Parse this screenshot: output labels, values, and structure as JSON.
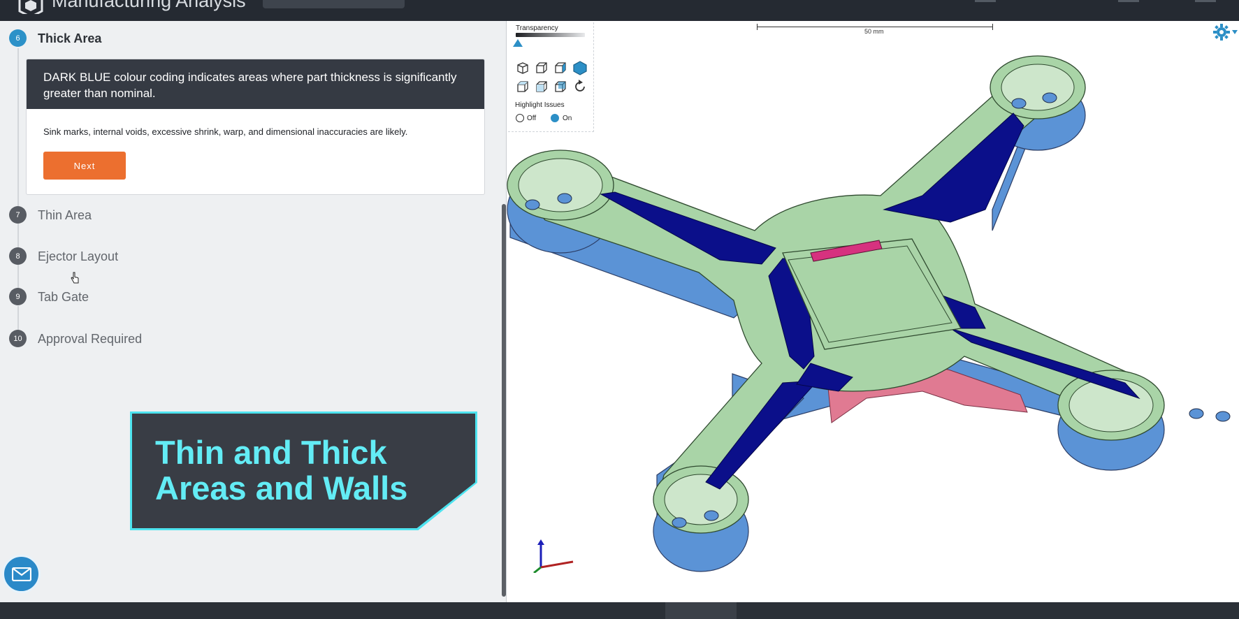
{
  "app": {
    "title": "Manufacturing Analysis",
    "logo_icon": "cube-logo-icon"
  },
  "steps": [
    {
      "number": "6",
      "label": "Thick Area",
      "active": true
    },
    {
      "number": "7",
      "label": "Thin Area",
      "active": false
    },
    {
      "number": "8",
      "label": "Ejector Layout",
      "active": false
    },
    {
      "number": "9",
      "label": "Tab Gate",
      "active": false
    },
    {
      "number": "10",
      "label": "Approval Required",
      "active": false
    }
  ],
  "card": {
    "heading": "DARK BLUE colour coding indicates areas where part thickness is significantly greater than nominal.",
    "body": "Sink marks, internal voids, excessive shrink, warp, and dimensional inaccuracies are likely.",
    "next_label": "Next"
  },
  "overlay": {
    "title": "Thin and Thick Areas and Walls"
  },
  "viewer_tools": {
    "transparency_label": "Transparency",
    "transparency_value": 0.0,
    "view_icons": [
      "iso-view-icon",
      "front-view-icon",
      "right-view-icon",
      "solid-view-icon",
      "top-view-icon",
      "left-view-icon",
      "back-view-icon",
      "reset-rotation-icon"
    ],
    "highlight_label": "Highlight Issues",
    "off_label": "Off",
    "on_label": "On",
    "highlight_selected": "On"
  },
  "scale": {
    "label": "50 mm"
  },
  "colors": {
    "accent": "#2c91c8",
    "next_button": "#ec6f2f",
    "thick_area": "#0b0f8a",
    "nominal": "#a9d4a7",
    "wall": "#5b93d6",
    "thin_area": "#e07a92",
    "overlay_text": "#63ecf5"
  },
  "icons": {
    "mail": "mail-icon",
    "settings": "gear-icon",
    "axis": "axis-triad-icon"
  }
}
